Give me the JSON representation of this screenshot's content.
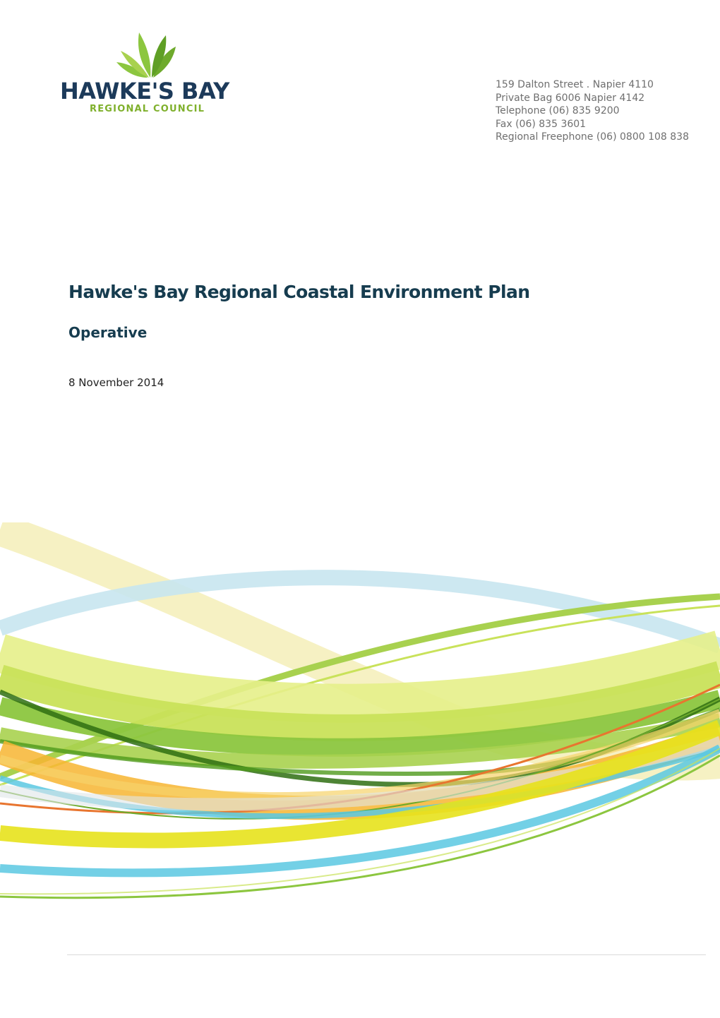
{
  "brand": {
    "name": "HAWKE'S BAY",
    "subname": "REGIONAL COUNCIL",
    "primary_color": "#1c3a5a",
    "accent_color": "#7fb02c"
  },
  "contact": {
    "address": "159 Dalton Street . Napier 4110",
    "private_bag": "Private Bag 6006 Napier 4142",
    "telephone": "Telephone (06) 835 9200",
    "fax": "Fax (06) 835 3601",
    "freephone": "Regional Freephone (06) 0800 108 838"
  },
  "document": {
    "title": "Hawke's Bay Regional Coastal Environment Plan",
    "status": "Operative",
    "date": "8 November 2014"
  },
  "graphic": {
    "colors": [
      "#c8e6f0",
      "#f4eeb8",
      "#e6ef8a",
      "#c9e25a",
      "#8cc63f",
      "#4f9a1c",
      "#2f6f12",
      "#f7b531",
      "#e8752f",
      "#5bc8e2",
      "#e7e21c"
    ]
  }
}
